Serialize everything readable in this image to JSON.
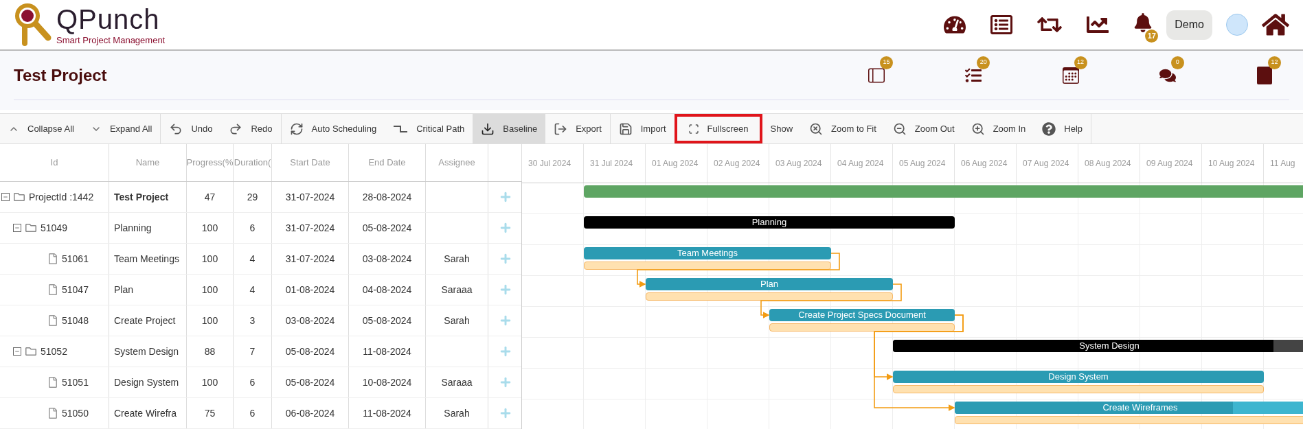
{
  "logo": {
    "name": "QPunch",
    "tagline": "Smart Project Management"
  },
  "header": {
    "notifications_badge": "17",
    "user_button": "Demo"
  },
  "project": {
    "title": "Test Project",
    "badges": [
      "15",
      "20",
      "12",
      "0",
      "12"
    ]
  },
  "toolbar": [
    [
      {
        "label": "Collapse All",
        "selected": false,
        "highlighted": false
      },
      {
        "label": "Expand All",
        "selected": false,
        "highlighted": false
      }
    ],
    [
      {
        "label": "Undo",
        "selected": false,
        "highlighted": false
      },
      {
        "label": "Redo",
        "selected": false,
        "highlighted": false
      }
    ],
    [
      {
        "label": "Auto Scheduling",
        "selected": false,
        "highlighted": false
      },
      {
        "label": "Critical Path",
        "selected": false,
        "highlighted": false
      },
      {
        "label": "Baseline",
        "selected": true,
        "highlighted": false
      },
      {
        "label": "Export",
        "selected": false,
        "highlighted": false
      }
    ],
    [
      {
        "label": "Import",
        "selected": false,
        "highlighted": false
      },
      {
        "label": "Fullscreen",
        "selected": false,
        "highlighted": true
      },
      {
        "label": "Show",
        "selected": false,
        "highlighted": false
      },
      {
        "label": "Zoom to Fit",
        "selected": false,
        "highlighted": false
      },
      {
        "label": "Zoom Out",
        "selected": false,
        "highlighted": false
      },
      {
        "label": "Zoom In",
        "selected": false,
        "highlighted": false
      },
      {
        "label": "Help",
        "selected": false,
        "highlighted": false
      }
    ]
  ],
  "table": {
    "columns": [
      "Id",
      "Name",
      "Progress(%",
      "Duration(",
      "Start Date",
      "End Date",
      "Assignee"
    ],
    "rows": [
      {
        "id": "ProjectId :1442",
        "name": "Test Project",
        "progress": "47",
        "duration": "29",
        "start": "31-07-2024",
        "end": "28-08-2024",
        "expanded": true,
        "children": [
          {
            "id": "51049",
            "name": "Planning",
            "progress": "100",
            "duration": "6",
            "start": "31-07-2024",
            "end": "05-08-2024",
            "expanded": true,
            "children": [
              {
                "id": "51061",
                "name": "Team Meetings",
                "progress": "100",
                "duration": "4",
                "start": "31-07-2024",
                "end": "03-08-2024",
                "assignee": "Sarah"
              },
              {
                "id": "51047",
                "name": "Plan",
                "progress": "100",
                "duration": "4",
                "start": "01-08-2024",
                "end": "04-08-2024",
                "assignee": "Saraaa"
              },
              {
                "id": "51048",
                "name": "Create Project",
                "progress": "100",
                "duration": "3",
                "start": "03-08-2024",
                "end": "05-08-2024",
                "assignee": "Sarah"
              }
            ]
          },
          {
            "id": "51052",
            "name": "System Design",
            "progress": "88",
            "duration": "7",
            "start": "05-08-2024",
            "end": "11-08-2024",
            "expanded": true,
            "children": [
              {
                "id": "51051",
                "name": "Design System",
                "progress": "100",
                "duration": "6",
                "start": "05-08-2024",
                "end": "10-08-2024",
                "assignee": "Saraaa"
              },
              {
                "id": "51050",
                "name": "Create Wirefra",
                "progress": "75",
                "duration": "6",
                "start": "06-08-2024",
                "end": "11-08-2024",
                "assignee": "Sarah"
              }
            ]
          }
        ]
      }
    ]
  },
  "gantt": {
    "days": [
      "30 Jul 2024",
      "31 Jul 2024",
      "01 Aug 2024",
      "02 Aug 2024",
      "03 Aug 2024",
      "04 Aug 2024",
      "05 Aug 2024",
      "06 Aug 2024",
      "07 Aug 2024",
      "08 Aug 2024",
      "09 Aug 2024",
      "10 Aug 2024",
      "11 Aug"
    ],
    "bars": [
      {
        "kind": "project"
      },
      {
        "kind": "summary",
        "label": "Planning"
      },
      {
        "kind": "task",
        "label": "Team Meetings"
      },
      {
        "kind": "task",
        "label": "Plan"
      },
      {
        "kind": "task",
        "label": "Create Project Specs Document"
      },
      {
        "kind": "summary",
        "label": "System Design",
        "level": 0.88
      },
      {
        "kind": "task",
        "label": "Design System"
      },
      {
        "kind": "task",
        "label": "Create Wireframes",
        "level": 0.75
      }
    ]
  }
}
